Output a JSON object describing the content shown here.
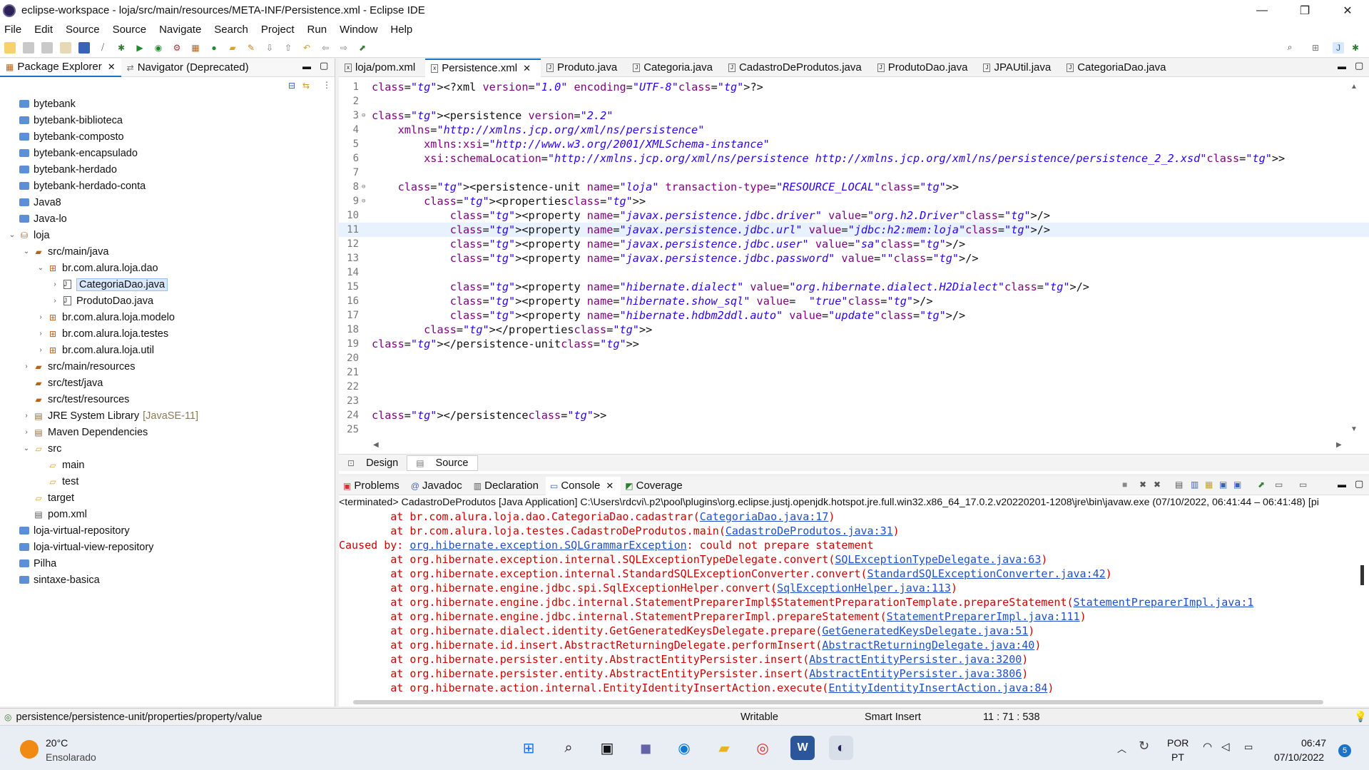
{
  "window": {
    "title": "eclipse-workspace - loja/src/main/resources/META-INF/Persistence.xml - Eclipse IDE",
    "minimize": "—",
    "restore": "❐",
    "close": "✕"
  },
  "menu": [
    "File",
    "Edit",
    "Source",
    "Source",
    "Navigate",
    "Search",
    "Project",
    "Run",
    "Window",
    "Help"
  ],
  "left_tabs": {
    "package_explorer": "Package Explorer",
    "navigator": "Navigator (Deprecated)"
  },
  "tree": [
    {
      "label": "bytebank",
      "type": "project",
      "indent": 0
    },
    {
      "label": "bytebank-biblioteca",
      "type": "project",
      "indent": 0
    },
    {
      "label": "bytebank-composto",
      "type": "project",
      "indent": 0
    },
    {
      "label": "bytebank-encapsulado",
      "type": "project",
      "indent": 0
    },
    {
      "label": "bytebank-herdado",
      "type": "project",
      "indent": 0
    },
    {
      "label": "bytebank-herdado-conta",
      "type": "project",
      "indent": 0
    },
    {
      "label": "Java8",
      "type": "project",
      "indent": 0
    },
    {
      "label": "Java-lo",
      "type": "project",
      "indent": 0
    },
    {
      "label": "loja",
      "type": "maven",
      "indent": 0,
      "expanded": true
    },
    {
      "label": "src/main/java",
      "type": "srcfolder",
      "indent": 1,
      "expanded": true
    },
    {
      "label": "br.com.alura.loja.dao",
      "type": "package",
      "indent": 2,
      "expanded": true
    },
    {
      "label": "CategoriaDao.java",
      "type": "java",
      "indent": 3,
      "selected": true
    },
    {
      "label": "ProdutoDao.java",
      "type": "java",
      "indent": 3
    },
    {
      "label": "br.com.alura.loja.modelo",
      "type": "package",
      "indent": 2
    },
    {
      "label": "br.com.alura.loja.testes",
      "type": "package",
      "indent": 2
    },
    {
      "label": "br.com.alura.loja.util",
      "type": "package",
      "indent": 2
    },
    {
      "label": "src/main/resources",
      "type": "srcfolder",
      "indent": 1
    },
    {
      "label": "src/test/java",
      "type": "srcfolder",
      "indent": 1
    },
    {
      "label": "src/test/resources",
      "type": "srcfolder",
      "indent": 1
    },
    {
      "label": "JRE System Library",
      "suffix": "[JavaSE-11]",
      "type": "library",
      "indent": 1
    },
    {
      "label": "Maven Dependencies",
      "type": "library",
      "indent": 1
    },
    {
      "label": "src",
      "type": "folder",
      "indent": 1,
      "expanded": true
    },
    {
      "label": "main",
      "type": "folder",
      "indent": 2
    },
    {
      "label": "test",
      "type": "folder",
      "indent": 2
    },
    {
      "label": "target",
      "type": "folder",
      "indent": 1
    },
    {
      "label": "pom.xml",
      "type": "xml",
      "indent": 1
    },
    {
      "label": "loja-virtual-repository",
      "type": "project",
      "indent": 0
    },
    {
      "label": "loja-virtual-view-repository",
      "type": "project",
      "indent": 0
    },
    {
      "label": "Pilha",
      "type": "project",
      "indent": 0
    },
    {
      "label": "sintaxe-basica",
      "type": "project",
      "indent": 0
    }
  ],
  "editor_tabs": [
    "loja/pom.xml",
    "Persistence.xml",
    "Produto.java",
    "Categoria.java",
    "CadastroDeProdutos.java",
    "ProdutoDao.java",
    "JPAUtil.java",
    "CategoriaDao.java"
  ],
  "code_lines": [
    {
      "n": "1",
      "text": "<?xml version=\"1.0\" encoding=\"UTF-8\"?>"
    },
    {
      "n": "2",
      "text": ""
    },
    {
      "n": "3",
      "text": "<persistence version=\"2.2\"",
      "fold": true
    },
    {
      "n": "4",
      "text": "    xmlns=\"http://xmlns.jcp.org/xml/ns/persistence\""
    },
    {
      "n": "5",
      "text": "        xmlns:xsi=\"http://www.w3.org/2001/XMLSchema-instance\""
    },
    {
      "n": "6",
      "text": "        xsi:schemaLocation=\"http://xmlns.jcp.org/xml/ns/persistence http://xmlns.jcp.org/xml/ns/persistence/persistence_2_2.xsd\">"
    },
    {
      "n": "7",
      "text": ""
    },
    {
      "n": "8",
      "text": "    <persistence-unit name=\"loja\" transaction-type=\"RESOURCE_LOCAL\">",
      "fold": true
    },
    {
      "n": "9",
      "text": "        <properties>",
      "fold": true
    },
    {
      "n": "10",
      "text": "            <property name=\"javax.persistence.jdbc.driver\" value=\"org.h2.Driver\"/>"
    },
    {
      "n": "11",
      "text": "            <property name=\"javax.persistence.jdbc.url\" value=\"jdbc:h2:mem:loja\"/>",
      "current": true
    },
    {
      "n": "12",
      "text": "            <property name=\"javax.persistence.jdbc.user\" value=\"sa\"/>"
    },
    {
      "n": "13",
      "text": "            <property name=\"javax.persistence.jdbc.password\" value=\"\"/>"
    },
    {
      "n": "14",
      "text": ""
    },
    {
      "n": "15",
      "text": "            <property name=\"hibernate.dialect\" value=\"org.hibernate.dialect.H2Dialect\"/>"
    },
    {
      "n": "16",
      "text": "            <property name=\"hibernate.show_sql\" value=  \"true\"/>"
    },
    {
      "n": "17",
      "text": "            <property name=\"hibernate.hdbm2ddl.auto\" value=\"update\"/>"
    },
    {
      "n": "18",
      "text": "        </properties>"
    },
    {
      "n": "19",
      "text": "</persistence-unit>"
    },
    {
      "n": "20",
      "text": ""
    },
    {
      "n": "21",
      "text": ""
    },
    {
      "n": "22",
      "text": ""
    },
    {
      "n": "23",
      "text": ""
    },
    {
      "n": "24",
      "text": "</persistence>"
    },
    {
      "n": "25",
      "text": ""
    }
  ],
  "editor_bottom_tabs": {
    "design": "Design",
    "source": "Source"
  },
  "console_tabs": [
    "Problems",
    "Javadoc",
    "Declaration",
    "Console",
    "Coverage"
  ],
  "console_header": "<terminated> CadastroDeProdutos [Java Application] C:\\Users\\rdcvi\\.p2\\pool\\plugins\\org.eclipse.justj.openjdk.hotspot.jre.full.win32.x86_64_17.0.2.v20220201-1208\\jre\\bin\\javaw.exe  (07/10/2022, 06:41:44 – 06:41:48) [pi",
  "console_lines": [
    {
      "pre": "        at br.com.alura.loja.dao.CategoriaDao.cadastrar(",
      "link": "CategoriaDao.java:17",
      "post": ")"
    },
    {
      "pre": "        at br.com.alura.loja.testes.CadastroDeProdutos.main(",
      "link": "CadastroDeProdutos.java:31",
      "post": ")"
    },
    {
      "pre": "Caused by: ",
      "link": "org.hibernate.exception.SQLGrammarException",
      "post": ": could not prepare statement"
    },
    {
      "pre": "        at org.hibernate.exception.internal.SQLExceptionTypeDelegate.convert(",
      "link": "SQLExceptionTypeDelegate.java:63",
      "post": ")"
    },
    {
      "pre": "        at org.hibernate.exception.internal.StandardSQLExceptionConverter.convert(",
      "link": "StandardSQLExceptionConverter.java:42",
      "post": ")"
    },
    {
      "pre": "        at org.hibernate.engine.jdbc.spi.SqlExceptionHelper.convert(",
      "link": "SqlExceptionHelper.java:113",
      "post": ")"
    },
    {
      "pre": "        at org.hibernate.engine.jdbc.internal.StatementPreparerImpl$StatementPreparationTemplate.prepareStatement(",
      "link": "StatementPreparerImpl.java:1",
      "post": ""
    },
    {
      "pre": "        at org.hibernate.engine.jdbc.internal.StatementPreparerImpl.prepareStatement(",
      "link": "StatementPreparerImpl.java:111",
      "post": ")"
    },
    {
      "pre": "        at org.hibernate.dialect.identity.GetGeneratedKeysDelegate.prepare(",
      "link": "GetGeneratedKeysDelegate.java:51",
      "post": ")"
    },
    {
      "pre": "        at org.hibernate.id.insert.AbstractReturningDelegate.performInsert(",
      "link": "AbstractReturningDelegate.java:40",
      "post": ")"
    },
    {
      "pre": "        at org.hibernate.persister.entity.AbstractEntityPersister.insert(",
      "link": "AbstractEntityPersister.java:3200",
      "post": ")"
    },
    {
      "pre": "        at org.hibernate.persister.entity.AbstractEntityPersister.insert(",
      "link": "AbstractEntityPersister.java:3806",
      "post": ")"
    },
    {
      "pre": "        at org.hibernate.action.internal.EntityIdentityInsertAction.execute(",
      "link": "EntityIdentityInsertAction.java:84",
      "post": ")"
    }
  ],
  "status": {
    "path": "persistence/persistence-unit/properties/property/value",
    "writable": "Writable",
    "insert_mode": "Smart Insert",
    "position": "11 : 71 : 538"
  },
  "taskbar": {
    "temperature": "20°C",
    "weather": "Ensolarado",
    "lang_top": "POR",
    "lang_bottom": "PT",
    "time": "06:47",
    "date": "07/10/2022",
    "notifications": "5"
  }
}
